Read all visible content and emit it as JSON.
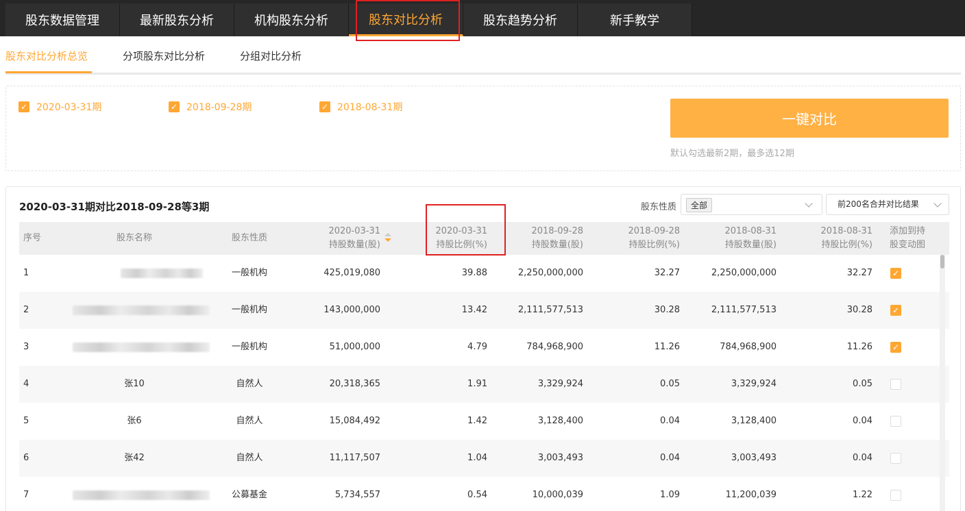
{
  "nav": {
    "tabs": [
      {
        "label": "股东数据管理"
      },
      {
        "label": "最新股东分析"
      },
      {
        "label": "机构股东分析"
      },
      {
        "label": "股东对比分析"
      },
      {
        "label": "股东趋势分析"
      },
      {
        "label": "新手教学"
      }
    ],
    "active_index": 3
  },
  "subnav": {
    "tabs": [
      {
        "label": "股东对比分析总览"
      },
      {
        "label": "分项股东对比分析"
      },
      {
        "label": "分组对比分析"
      }
    ],
    "active_index": 0
  },
  "periods": {
    "items": [
      {
        "label": "2020-03-31期",
        "checked": true
      },
      {
        "label": "2018-09-28期",
        "checked": true
      },
      {
        "label": "2018-08-31期",
        "checked": true
      }
    ],
    "compare_button": "一键对比",
    "hint": "默认勾选最新2期，最多选12期"
  },
  "result": {
    "title": "2020-03-31期对比2018-09-28等3期",
    "filter_label": "股东性质",
    "filter_value": "全部",
    "merge_select": "前200名合并对比结果"
  },
  "table": {
    "headers": {
      "index": "序号",
      "name": "股东名称",
      "type": "股东性质",
      "c1_line1": "2020-03-31",
      "c1_line2": "持股数量(股)",
      "c2_line1": "2020-03-31",
      "c2_line2": "持股比例(%)",
      "c3_line1": "2018-09-28",
      "c3_line2": "持股数量(股)",
      "c4_line1": "2018-09-28",
      "c4_line2": "持股比例(%)",
      "c5_line1": "2018-08-31",
      "c5_line2": "持股数量(股)",
      "c6_line1": "2018-08-31",
      "c6_line2": "持股比例(%)",
      "add_line1": "添加到持",
      "add_line2": "股变动图"
    },
    "rows": [
      {
        "index": "1",
        "name": "",
        "name_blurred": true,
        "type": "一般机构",
        "c1": "425,019,080",
        "c2": "39.88",
        "c3": "2,250,000,000",
        "c4": "32.27",
        "c5": "2,250,000,000",
        "c6": "32.27",
        "added": true
      },
      {
        "index": "2",
        "name": "",
        "name_blurred": true,
        "type": "一般机构",
        "c1": "143,000,000",
        "c2": "13.42",
        "c3": "2,111,577,513",
        "c4": "30.28",
        "c5": "2,111,577,513",
        "c6": "30.28",
        "added": true
      },
      {
        "index": "3",
        "name": "",
        "name_blurred": true,
        "type": "一般机构",
        "c1": "51,000,000",
        "c2": "4.79",
        "c3": "784,968,900",
        "c4": "11.26",
        "c5": "784,968,900",
        "c6": "11.26",
        "added": true
      },
      {
        "index": "4",
        "name": "张10",
        "name_blurred": false,
        "type": "自然人",
        "c1": "20,318,365",
        "c2": "1.91",
        "c3": "3,329,924",
        "c4": "0.05",
        "c5": "3,329,924",
        "c6": "0.05",
        "added": false
      },
      {
        "index": "5",
        "name": "张6",
        "name_blurred": false,
        "type": "自然人",
        "c1": "15,084,492",
        "c2": "1.42",
        "c3": "3,128,400",
        "c4": "0.04",
        "c5": "3,128,400",
        "c6": "0.04",
        "added": false
      },
      {
        "index": "6",
        "name": "张42",
        "name_blurred": false,
        "type": "自然人",
        "c1": "11,117,507",
        "c2": "1.04",
        "c3": "3,003,493",
        "c4": "0.04",
        "c5": "3,003,493",
        "c6": "0.04",
        "added": false
      },
      {
        "index": "7",
        "name": "",
        "name_blurred": true,
        "type": "公募基金",
        "c1": "5,734,557",
        "c2": "0.54",
        "c3": "10,000,039",
        "c4": "1.09",
        "c5": "11,200,039",
        "c6": "1.22",
        "added": false
      }
    ]
  },
  "colors": {
    "accent": "#ffa733",
    "nav_bg": "#262626",
    "highlight_box": "#e02020"
  },
  "icons": {
    "checkbox": "check-icon",
    "sort": "sort-icon",
    "dropdown": "chevron-down-icon"
  }
}
